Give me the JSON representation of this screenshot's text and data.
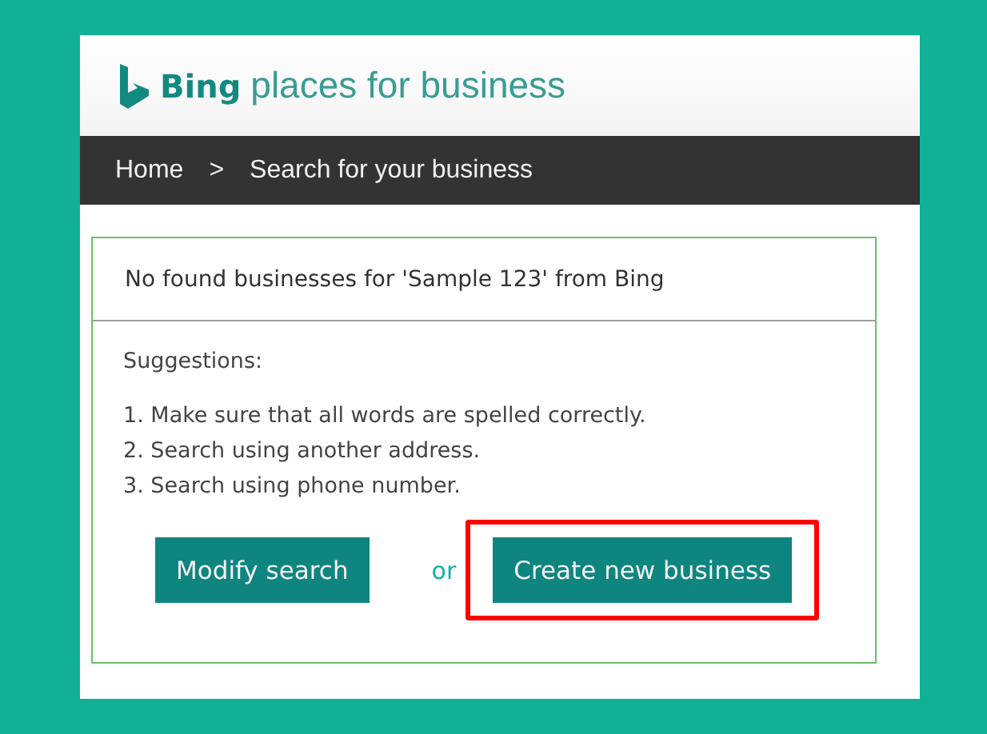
{
  "header": {
    "brand": "Bing",
    "tagline": "places for business"
  },
  "breadcrumb": [
    {
      "label": "Home"
    },
    {
      "label": ">"
    },
    {
      "label": "Search for your business"
    }
  ],
  "result": {
    "message": "No found businesses for 'Sample 123' from Bing",
    "suggestions_title": "Suggestions:",
    "suggestions": [
      "1. Make sure that all words are spelled correctly.",
      "2. Search using another address.",
      "3. Search using phone number."
    ],
    "actions": [
      {
        "kind": "button",
        "label": "Modify search",
        "highlighted": false
      },
      {
        "kind": "text",
        "label": "or"
      },
      {
        "kind": "button",
        "label": "Create new business",
        "highlighted": true
      }
    ]
  }
}
